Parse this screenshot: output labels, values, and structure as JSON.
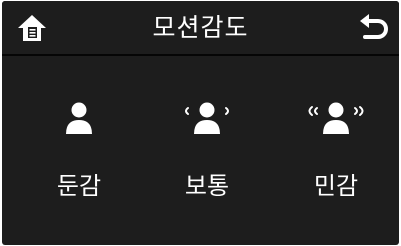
{
  "header": {
    "title": "모션감도",
    "home_icon": "home-icon",
    "back_icon": "back-arrow-icon"
  },
  "options": [
    {
      "id": "low",
      "label": "둔감",
      "icon": "person-icon"
    },
    {
      "id": "mid",
      "label": "보통",
      "icon": "person-single-waves-icon"
    },
    {
      "id": "high",
      "label": "민감",
      "icon": "person-double-waves-icon"
    }
  ],
  "colors": {
    "background": "#1d1d1d",
    "text": "#ffffff",
    "divider": "#050505"
  }
}
